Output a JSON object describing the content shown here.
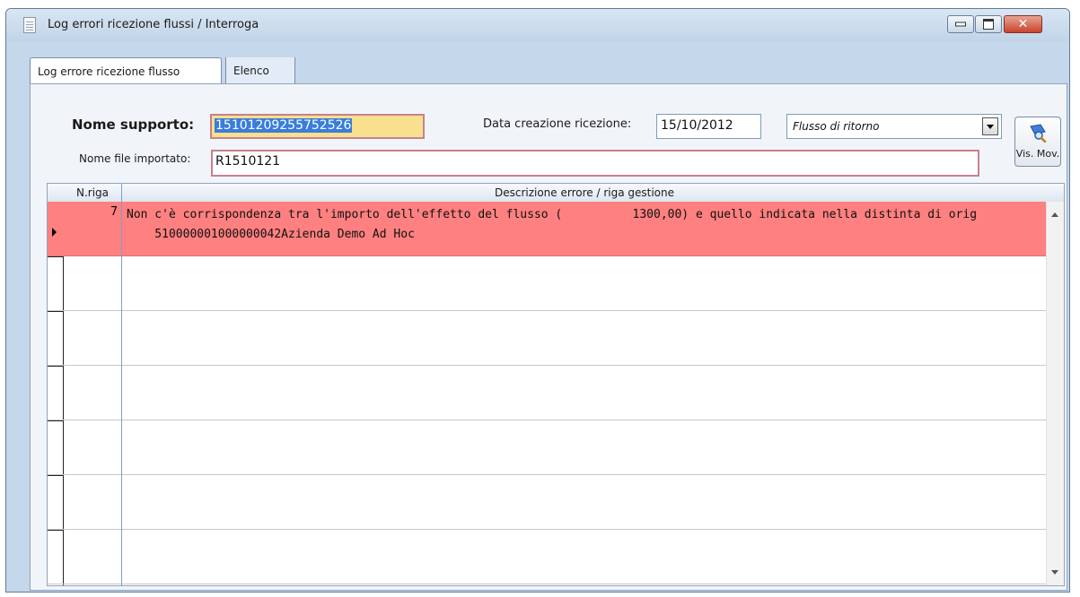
{
  "window": {
    "title": "Log errori ricezione flussi / Interroga"
  },
  "tabs": [
    {
      "label": "Log errore ricezione flusso",
      "active": true
    },
    {
      "label": "Elenco",
      "active": false
    }
  ],
  "form": {
    "nome_supporto_label": "Nome supporto:",
    "nome_supporto_value": "15101209255752526",
    "data_creazione_label": "Data creazione ricezione:",
    "data_creazione_value": "15/10/2012",
    "tipo_flusso_value": "Flusso di ritorno",
    "nome_file_label": "Nome file importato:",
    "nome_file_value": "R1510121",
    "vis_mov_label": "Vis. Mov."
  },
  "grid": {
    "columns": [
      "N.riga",
      "Descrizione errore / riga gestione"
    ],
    "rows": [
      {
        "n_riga": "7",
        "line1": "Non c'è corrispondenza tra l'importo dell'effetto del flusso (          1300,00) e quello indicata nella distinta di orig",
        "line2": "    510000001000000042Azienda Demo Ad Hoc"
      }
    ]
  },
  "colors": {
    "error_row": "#ff8080",
    "title_bar": "#c5d7ea",
    "selection": "#3a7ddc"
  }
}
